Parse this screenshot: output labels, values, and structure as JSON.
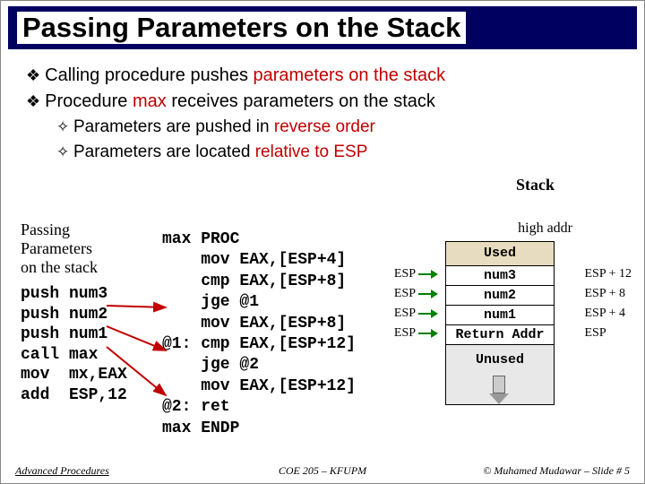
{
  "title": "Passing Parameters on the Stack",
  "bullets": {
    "b1a_pre": "Calling procedure pushes ",
    "b1a_red": "parameters on the stack",
    "b1b_pre": "Procedure ",
    "b1b_red": "max",
    "b1b_post": " receives parameters on the stack",
    "b2a_pre": "Parameters are pushed in ",
    "b2a_red": "reverse order",
    "b2b_pre": "Parameters are located ",
    "b2b_red": "relative to ESP"
  },
  "caller_label": "Passing\nParameters\non the stack",
  "caller_code": "push num3\npush num2\npush num1\ncall max\nmov  mx,EAX\nadd  ESP,12",
  "callee_code": "max PROC\n    mov EAX,[ESP+4]\n    cmp EAX,[ESP+8]\n    jge @1\n    mov EAX,[ESP+8]\n@1: cmp EAX,[ESP+12]\n    jge @2\n    mov EAX,[ESP+12]\n@2: ret\nmax ENDP",
  "stack": {
    "label": "Stack",
    "high": "high addr",
    "cells": [
      "Used",
      "num3",
      "num2",
      "num1",
      "Return Addr"
    ],
    "unused": "Unused",
    "offsets": [
      "ESP + 12",
      "ESP + 8",
      "ESP + 4",
      "ESP"
    ],
    "ptr": "ESP"
  },
  "footer": {
    "left": "Advanced Procedures",
    "center": "COE 205 – KFUPM",
    "right": "© Muhamed Mudawar – Slide # 5"
  }
}
